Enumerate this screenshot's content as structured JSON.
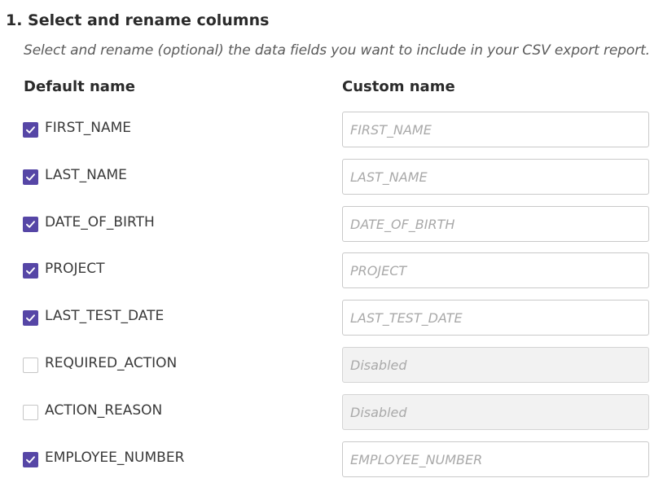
{
  "section": {
    "title": "1. Select and rename columns",
    "description": "Select and rename (optional) the data fields you want to include in your CSV export report."
  },
  "headers": {
    "default_name": "Default name",
    "custom_name": "Custom name"
  },
  "accent_color": "#5646a6",
  "rows": [
    {
      "label": "FIRST_NAME",
      "checked": true,
      "placeholder": "FIRST_NAME"
    },
    {
      "label": "LAST_NAME",
      "checked": true,
      "placeholder": "LAST_NAME"
    },
    {
      "label": "DATE_OF_BIRTH",
      "checked": true,
      "placeholder": "DATE_OF_BIRTH"
    },
    {
      "label": "PROJECT",
      "checked": true,
      "placeholder": "PROJECT"
    },
    {
      "label": "LAST_TEST_DATE",
      "checked": true,
      "placeholder": "LAST_TEST_DATE"
    },
    {
      "label": "REQUIRED_ACTION",
      "checked": false,
      "placeholder": "Disabled"
    },
    {
      "label": "ACTION_REASON",
      "checked": false,
      "placeholder": "Disabled"
    },
    {
      "label": "EMPLOYEE_NUMBER",
      "checked": true,
      "placeholder": "EMPLOYEE_NUMBER"
    }
  ]
}
